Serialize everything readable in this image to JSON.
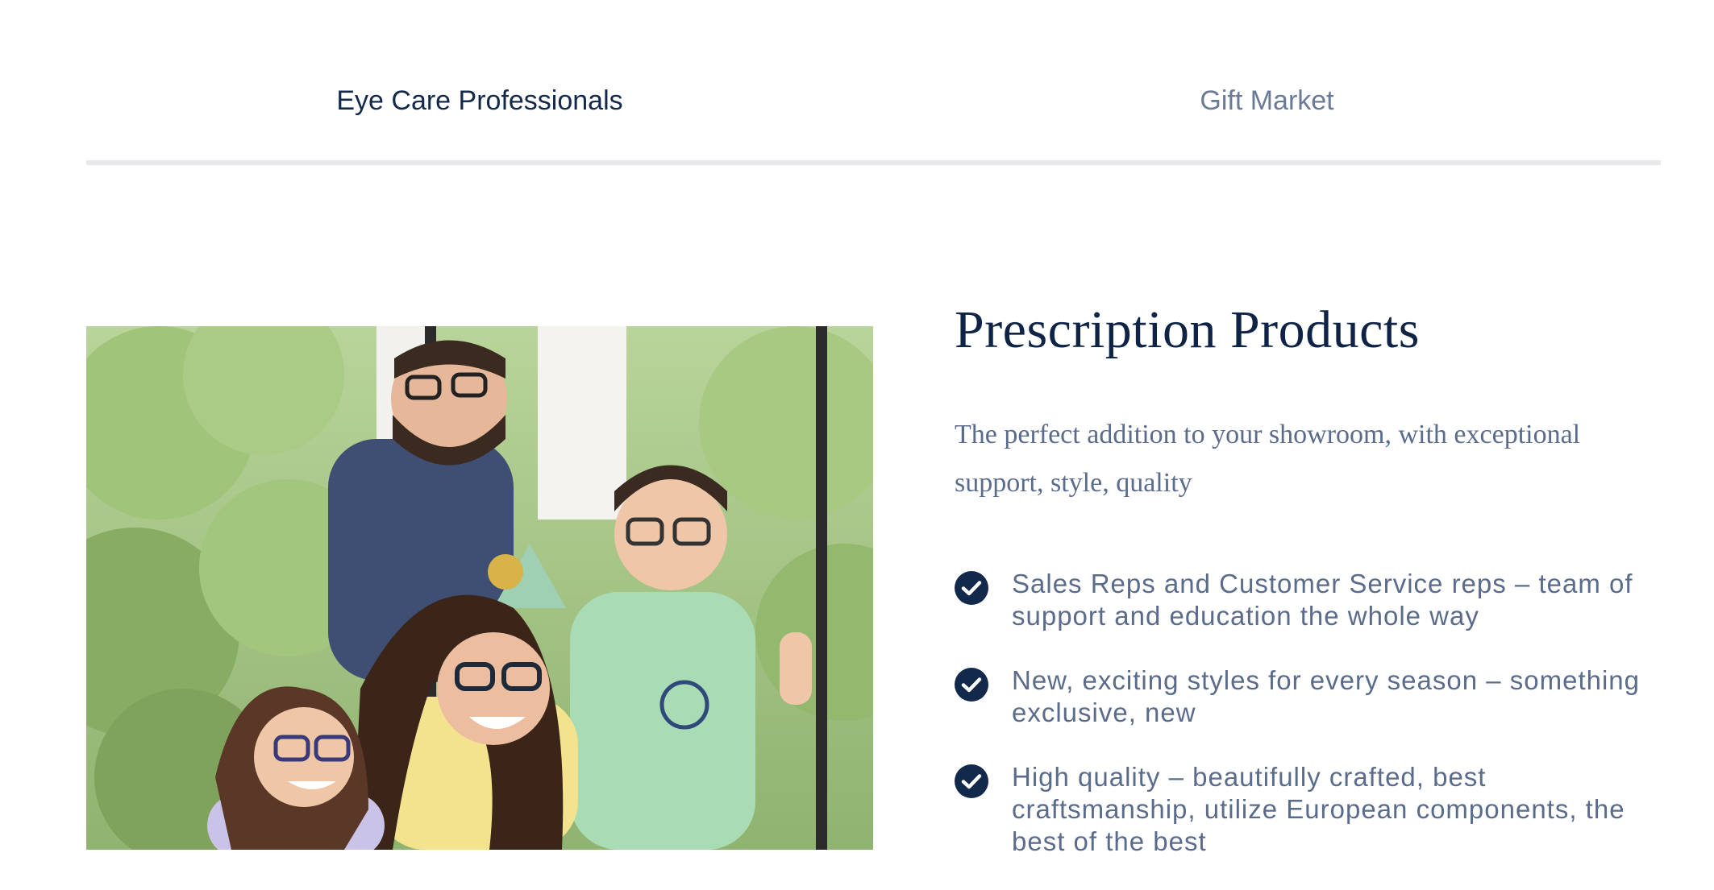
{
  "tabs": [
    {
      "label": "Eye Care Professionals",
      "active": true
    },
    {
      "label": "Gift Market",
      "active": false
    }
  ],
  "section": {
    "heading": "Prescription Products",
    "subtitle": "The perfect addition to your showroom, with exceptional support, style, quality",
    "features": [
      {
        "icon": "check-circle-icon",
        "text": "Sales Reps and Customer Service reps – team of support and education the whole way"
      },
      {
        "icon": "check-circle-icon",
        "text": "New, exciting styles for every season – something exclusive, new"
      },
      {
        "icon": "check-circle-icon",
        "text": "High quality – beautifully crafted, best craftsmanship, utilize European components, the best of the best"
      }
    ]
  },
  "photo": {
    "icon": "family-photo"
  },
  "colors": {
    "navy": "#13294b",
    "heading": "#0f2347",
    "body_text": "#5a6b8c",
    "inactive_tab": "#6b7a96",
    "divider": "#e8e8ea"
  }
}
